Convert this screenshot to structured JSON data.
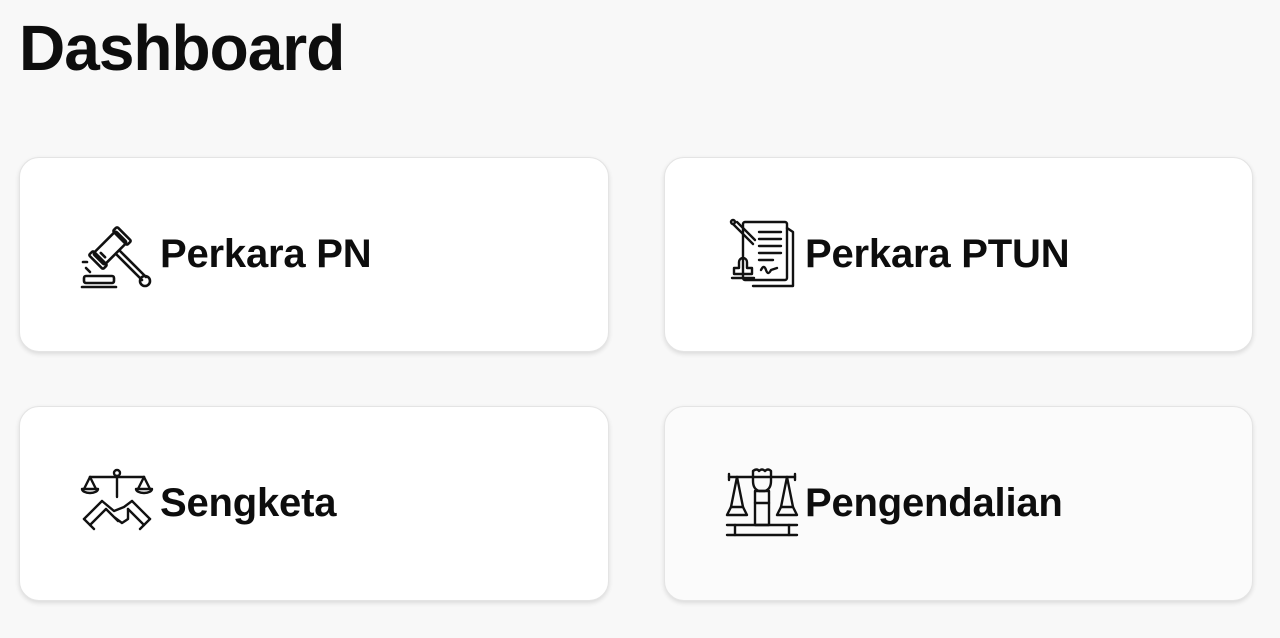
{
  "page": {
    "title": "Dashboard"
  },
  "cards": [
    {
      "label": "Perkara PN",
      "icon": "gavel-icon"
    },
    {
      "label": "Perkara PTUN",
      "icon": "document-stamp-icon"
    },
    {
      "label": "Sengketa",
      "icon": "justice-handshake-icon"
    },
    {
      "label": "Pengendalian",
      "icon": "fist-scales-icon"
    }
  ]
}
